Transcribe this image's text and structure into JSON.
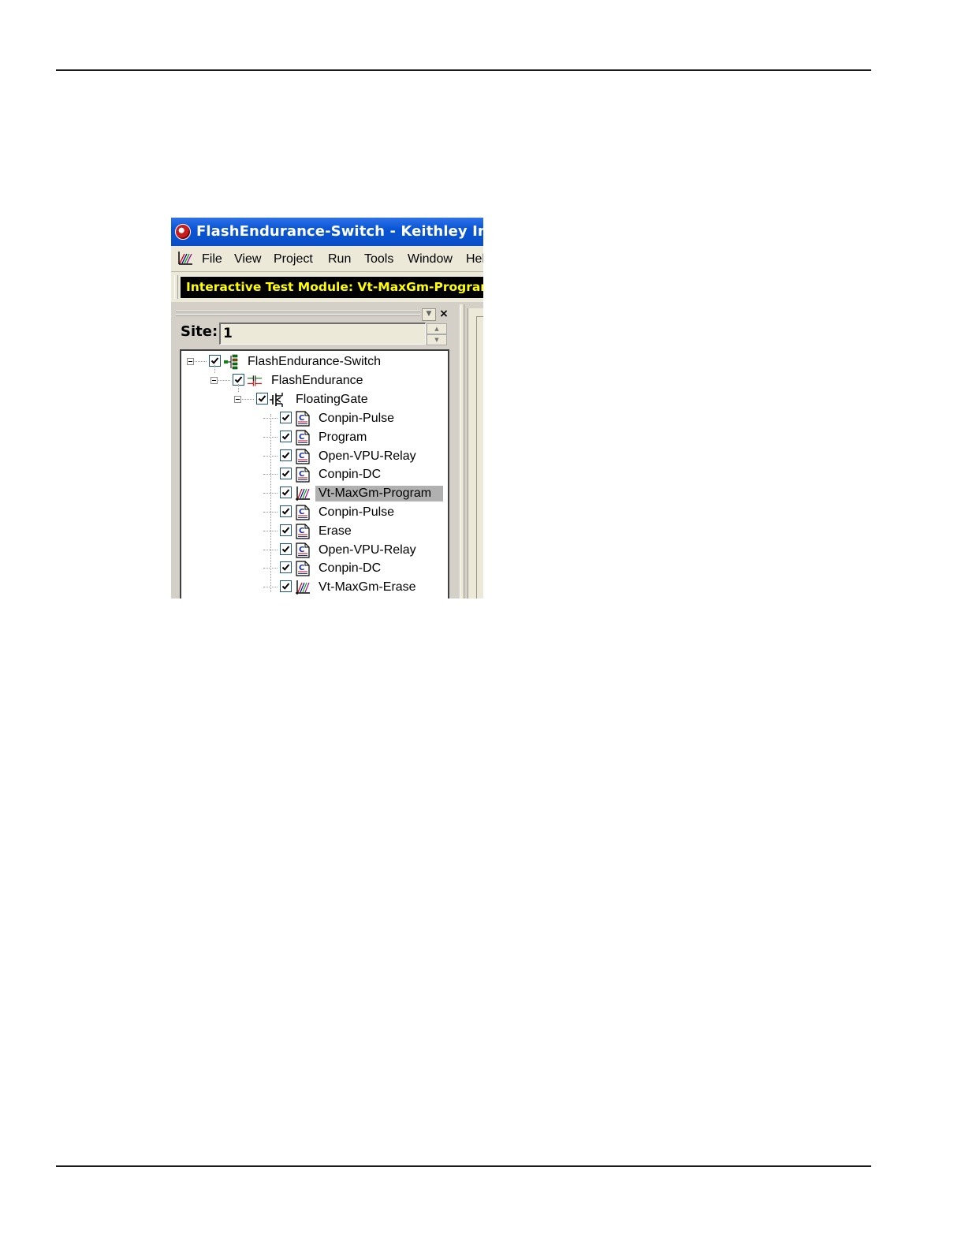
{
  "window": {
    "title": "FlashEndurance-Switch - Keithley Intera"
  },
  "menu": {
    "items": [
      "File",
      "View",
      "Project",
      "Run",
      "Tools",
      "Window",
      "Hel"
    ]
  },
  "toolbar": {
    "module_banner": "Interactive Test Module: Vt-MaxGm-Program"
  },
  "site": {
    "label": "Site:",
    "value": "1"
  },
  "panel": {
    "close_glyph": "×"
  },
  "tree": {
    "project": {
      "label": "FlashEndurance-Switch",
      "icon": "project-tree-icon",
      "checked": true
    },
    "subsite": {
      "label": "FlashEndurance",
      "icon": "subsite-capacitor-icon",
      "checked": true
    },
    "device": {
      "label": "FloatingGate",
      "icon": "transistor-device-icon",
      "checked": true
    },
    "tests": [
      {
        "label": "Conpin-Pulse",
        "icon": "c-module-icon",
        "checked": true,
        "selected": false
      },
      {
        "label": "Program",
        "icon": "c-module-icon",
        "checked": true,
        "selected": false
      },
      {
        "label": "Open-VPU-Relay",
        "icon": "c-module-icon",
        "checked": true,
        "selected": false
      },
      {
        "label": "Conpin-DC",
        "icon": "c-module-icon",
        "checked": true,
        "selected": false
      },
      {
        "label": "Vt-MaxGm-Program",
        "icon": "graph-test-icon",
        "checked": true,
        "selected": true
      },
      {
        "label": "Conpin-Pulse",
        "icon": "c-module-icon",
        "checked": true,
        "selected": false
      },
      {
        "label": "Erase",
        "icon": "c-module-icon",
        "checked": true,
        "selected": false
      },
      {
        "label": "Open-VPU-Relay",
        "icon": "c-module-icon",
        "checked": true,
        "selected": false
      },
      {
        "label": "Conpin-DC",
        "icon": "c-module-icon",
        "checked": true,
        "selected": false
      },
      {
        "label": "Vt-MaxGm-Erase",
        "icon": "graph-test-icon",
        "checked": true,
        "selected": false
      }
    ]
  }
}
